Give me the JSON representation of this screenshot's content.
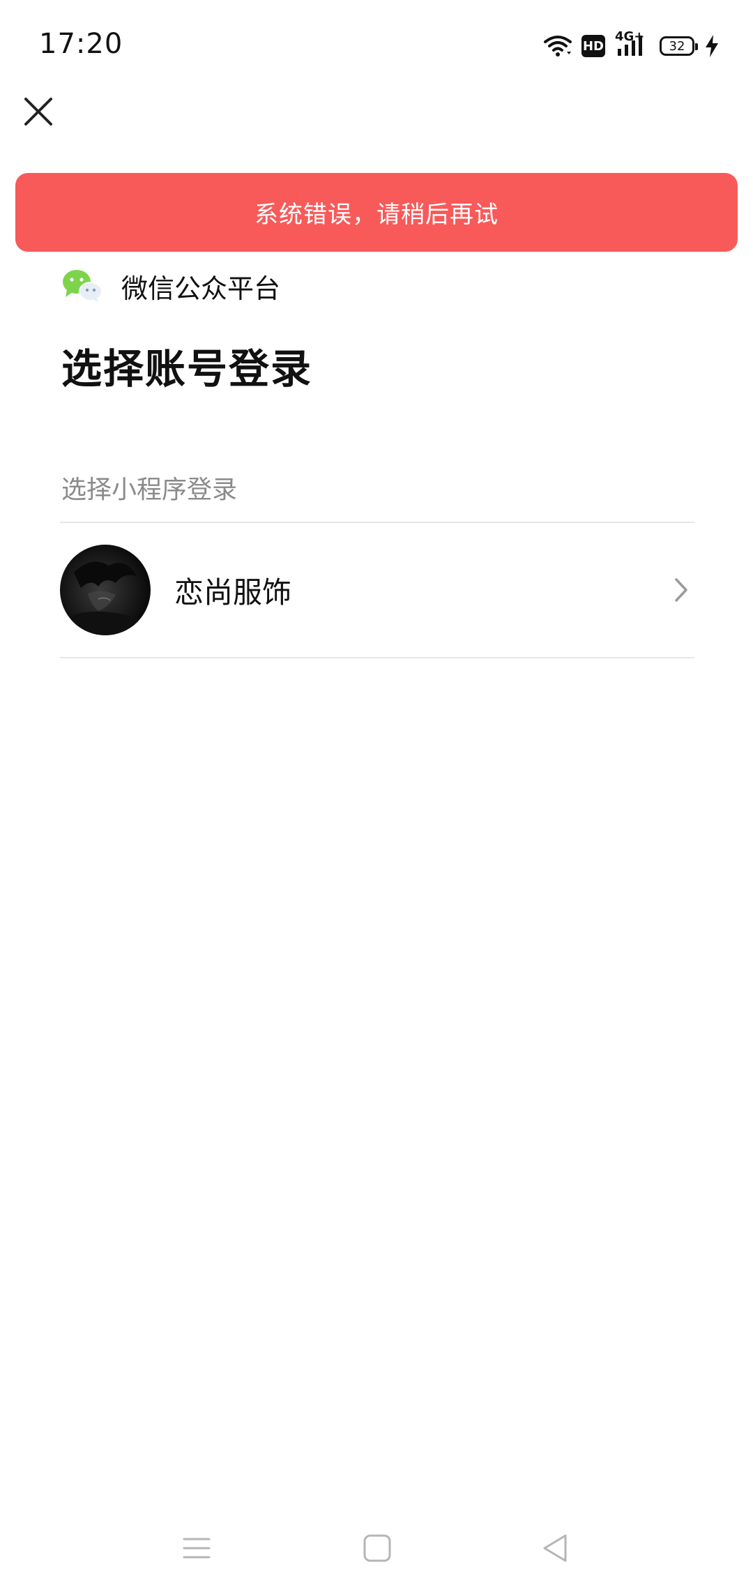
{
  "status_bar": {
    "time": "17:20",
    "network_type": "4G+",
    "hd_label": "HD",
    "battery_level": "32",
    "icons": [
      "wifi-icon",
      "hd-icon",
      "signal-icon",
      "battery-icon",
      "charging-icon"
    ]
  },
  "toolbar": {
    "close_icon": "close-icon"
  },
  "toast": {
    "message": "系统错误，请稍后再试",
    "color": "#f85a5a"
  },
  "platform": {
    "name": "微信公众平台",
    "icon": "wechat-icon"
  },
  "page": {
    "title": "选择账号登录"
  },
  "section": {
    "label": "选择小程序登录"
  },
  "accounts": [
    {
      "name": "恋尚服饰",
      "avatar": "avatar-image",
      "chevron": "chevron-right-icon"
    }
  ],
  "nav": {
    "items": [
      "menu-icon",
      "home-icon",
      "back-icon"
    ]
  }
}
